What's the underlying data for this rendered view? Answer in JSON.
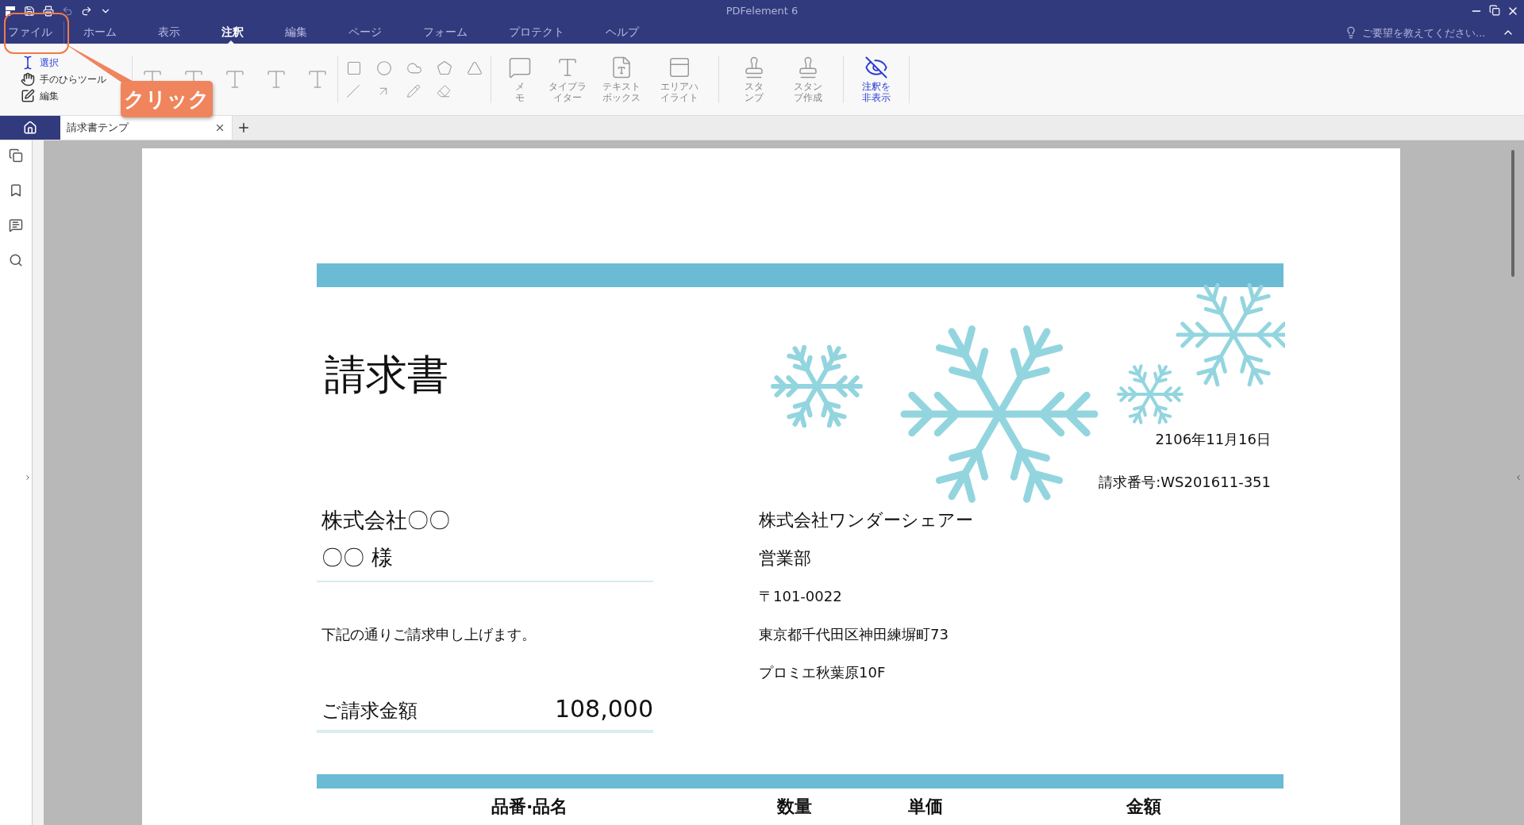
{
  "window": {
    "title": "PDFelement 6"
  },
  "menu_tabs": [
    {
      "label": "ファイル",
      "selected": false
    },
    {
      "label": "ホーム",
      "selected": false
    },
    {
      "label": "表示",
      "selected": false
    },
    {
      "label": "注釈",
      "selected": true
    },
    {
      "label": "編集",
      "selected": false
    },
    {
      "label": "ページ",
      "selected": false
    },
    {
      "label": "フォーム",
      "selected": false
    },
    {
      "label": "プロテクト",
      "selected": false
    },
    {
      "label": "ヘルプ",
      "selected": false
    }
  ],
  "help_search": {
    "placeholder": "ご要望を教えてください..."
  },
  "ribbon": {
    "select_tools": [
      {
        "kind": "select",
        "label": "選択",
        "selected": true
      },
      {
        "kind": "hand",
        "label": "手のひらツール",
        "selected": false
      },
      {
        "kind": "edit",
        "label": "編集",
        "selected": false
      }
    ],
    "tools": [
      {
        "kind": "memo",
        "label": "メモ"
      },
      {
        "kind": "typewriter",
        "label": "タイプライター"
      },
      {
        "kind": "textbox",
        "label": "テキストボックス"
      },
      {
        "kind": "area",
        "label": "エリアハイライト"
      },
      {
        "kind": "stamp",
        "label": "スタンプ"
      },
      {
        "kind": "stamp_create",
        "label": "スタンプ作成"
      }
    ],
    "hide_annotations": {
      "label": "注釈を非表示",
      "active": true
    }
  },
  "document_tabs": [
    {
      "label": "請求書テンプ",
      "selected": true
    }
  ],
  "callout": {
    "label": "クリック"
  },
  "invoice": {
    "title": "請求書",
    "date": "2106年11月16日",
    "number": "請求番号:WS201611-351",
    "client": [
      "株式会社〇〇",
      "〇〇 様"
    ],
    "message": "下記の通りご請求申し上げます。",
    "amount_label": "ご請求金額",
    "amount": "108,000",
    "sender": [
      "株式会社ワンダーシェアー",
      "営業部",
      "〒101-0022",
      "東京都千代田区神田練塀町73",
      "プロミエ秋葉原10F"
    ],
    "columns": [
      "品番·品名",
      "数量",
      "単価",
      "金額"
    ]
  }
}
